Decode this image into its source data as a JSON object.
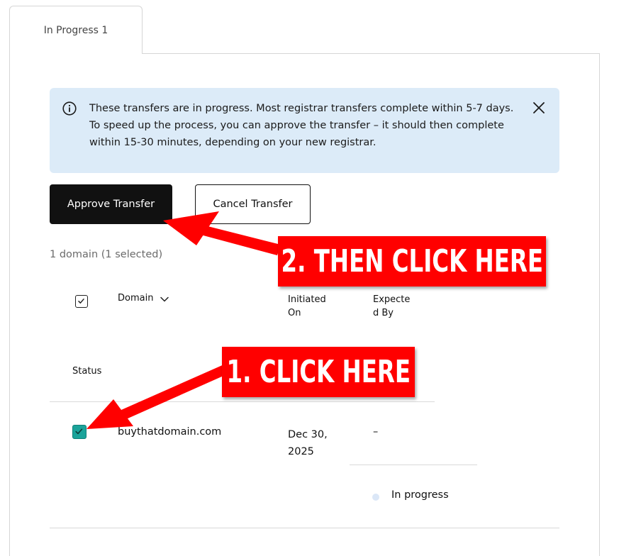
{
  "tab": {
    "label": "In Progress 1"
  },
  "banner": {
    "text": "These transfers are in progress. Most registrar transfers complete within 5-7 days. To speed up the process, you can approve the transfer – it should then complete within 15-30 minutes, depending on your new registrar."
  },
  "actions": {
    "approve_label": "Approve Transfer",
    "cancel_label": "Cancel Transfer"
  },
  "selection_summary": "1 domain (1 selected)",
  "table": {
    "headers": {
      "domain": "Domain",
      "initiated": "Initiated On",
      "expected": "Expected By",
      "status": "Status"
    },
    "rows": [
      {
        "domain": "buythatdomain.com",
        "initiated": "Dec 30, 2025",
        "expected": "–",
        "status": "In progress",
        "selected": true
      }
    ]
  },
  "annotations": {
    "step1": "1. CLICK HERE",
    "step2": "2. THEN CLICK HERE",
    "color": "#ff0000"
  },
  "colors": {
    "checkbox_checked": "#1aa39a",
    "banner_bg": "#dcebf8",
    "primary_button": "#111111"
  }
}
